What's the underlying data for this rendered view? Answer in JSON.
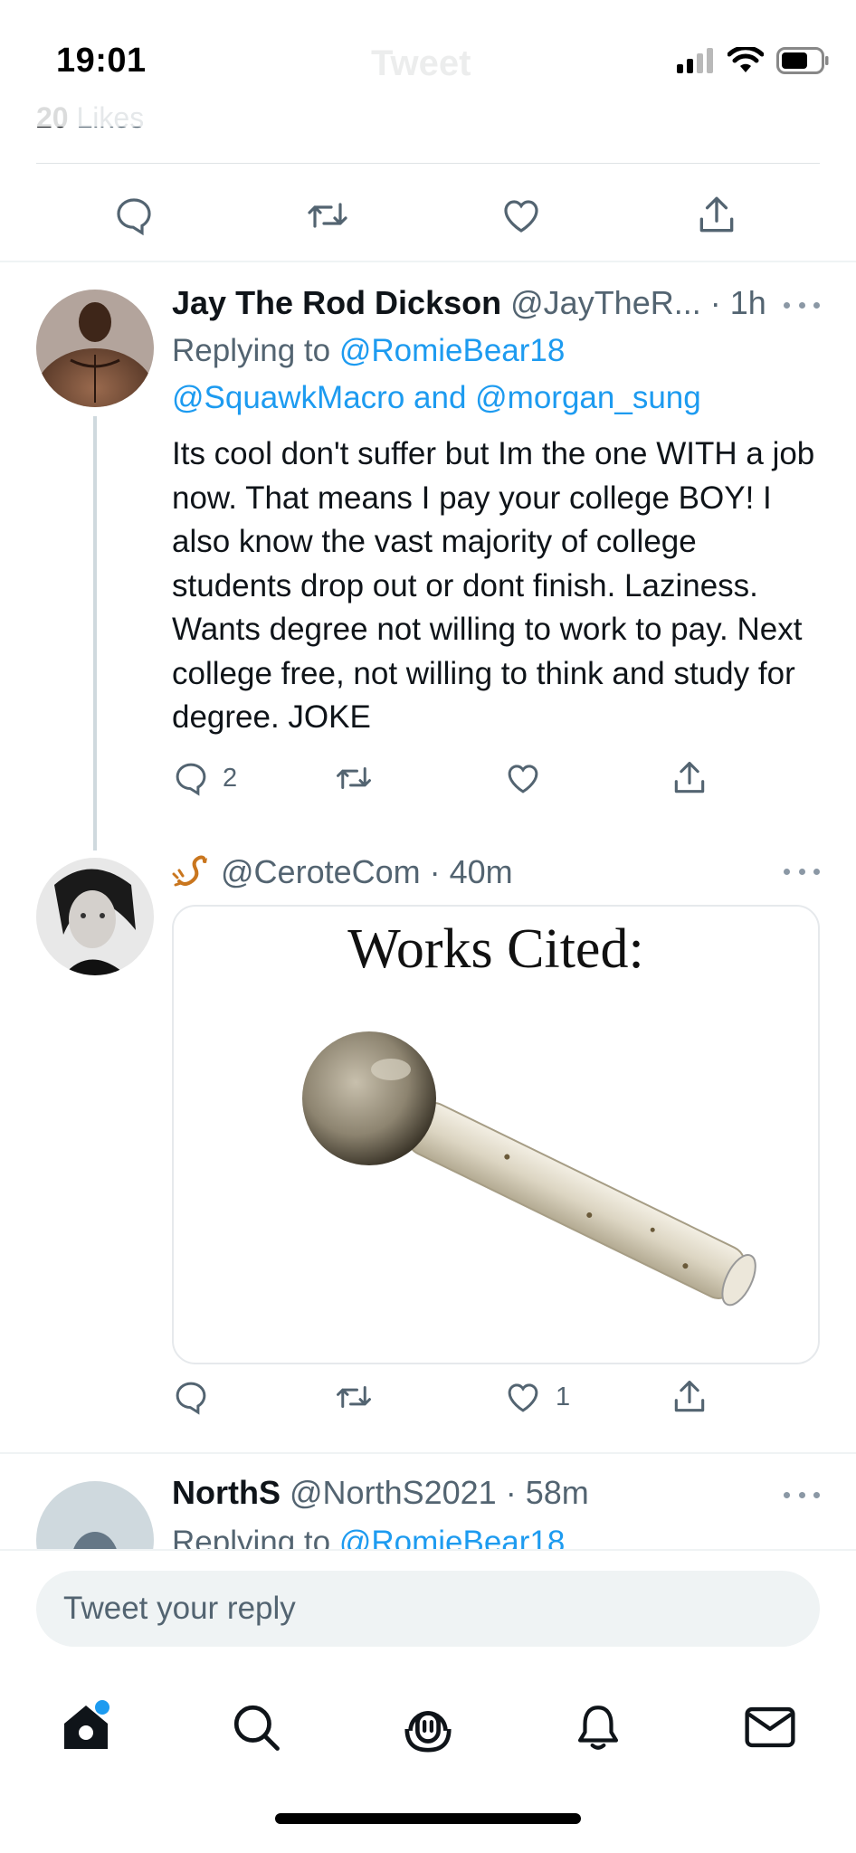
{
  "status_bar": {
    "time": "19:01"
  },
  "header": {
    "title": "Tweet"
  },
  "focused_tweet": {
    "likes_count": "20",
    "likes_label": " Likes"
  },
  "replies": [
    {
      "name": "Jay The Rod Dickson",
      "handle": "@JayTheR...",
      "time": "· 1h",
      "replying_prefix": "Replying to ",
      "replying_to": [
        "@RomieBear18",
        "@SquawkMacro",
        "@morgan_sung"
      ],
      "replying_and": " and ",
      "text": "Its cool don't suffer but Im the one WITH a job now. That means I pay your college BOY! I also know the vast majority of college students drop out or dont finish. Laziness. Wants degree not willing to work to pay. Next college free, not willing to think and study for degree. JOKE",
      "reply_count": "2",
      "retweet_count": "",
      "like_count": ""
    },
    {
      "name_emoji": "scorpion-emoji",
      "handle": "@CeroteCom",
      "time": "· 40m",
      "media_caption": "Works Cited:",
      "reply_count": "",
      "retweet_count": "",
      "like_count": "1"
    },
    {
      "name": "NorthS",
      "handle": "@NorthS2021",
      "time": "· 58m",
      "replying_prefix": "Replying to ",
      "replying_to": [
        "@RomieBear18"
      ]
    }
  ],
  "compose": {
    "placeholder": "Tweet your reply"
  },
  "colors": {
    "accent": "#1d9bf0",
    "secondary_text": "#536471",
    "primary_text": "#0f1419",
    "divider": "#eff3f4"
  },
  "tabbar": {
    "items": [
      "home-icon",
      "search-icon",
      "spaces-icon",
      "notifications-icon",
      "messages-icon"
    ]
  }
}
